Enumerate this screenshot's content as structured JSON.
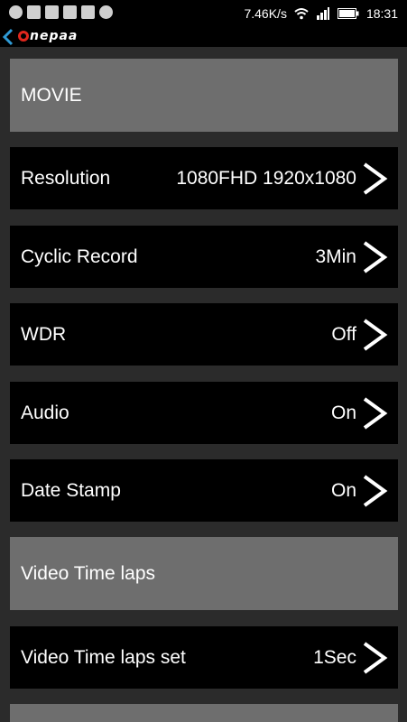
{
  "status_bar": {
    "net_speed": "7.46K/s",
    "time": "18:31"
  },
  "header": {
    "brand": "nepaa"
  },
  "sections": [
    {
      "label": "MOVIE"
    },
    {
      "label": "Video Time laps"
    }
  ],
  "rows": [
    {
      "label": "Resolution",
      "value": "1080FHD 1920x1080"
    },
    {
      "label": "Cyclic Record",
      "value": "3Min"
    },
    {
      "label": "WDR",
      "value": "Off"
    },
    {
      "label": "Audio",
      "value": "On"
    },
    {
      "label": "Date Stamp",
      "value": "On"
    },
    {
      "label": "Video Time laps set",
      "value": "1Sec"
    }
  ]
}
